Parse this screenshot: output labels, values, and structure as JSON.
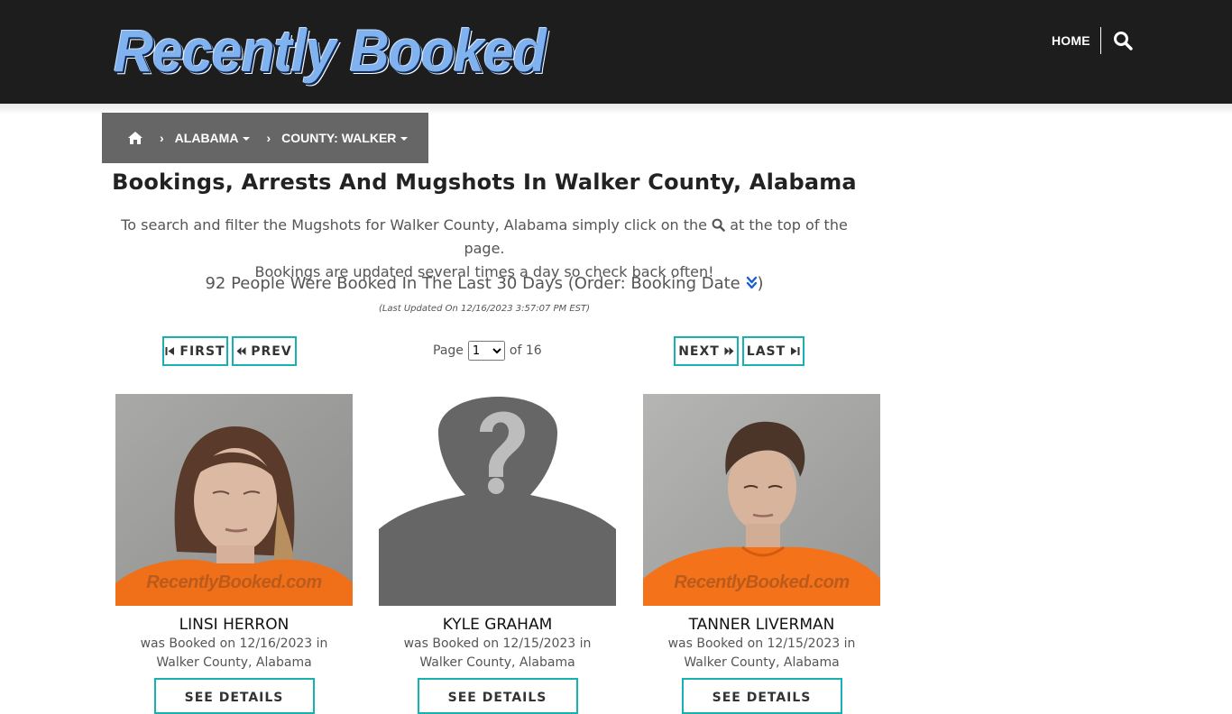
{
  "header": {
    "logo_text": "Recently Booked",
    "nav_home": "HOME",
    "search_icon": "search-icon"
  },
  "breadcrumb": {
    "home_icon": "home-icon",
    "state": "ALABAMA",
    "county": "COUNTY: WALKER"
  },
  "main": {
    "title": "Bookings, Arrests And Mugshots In Walker County, Alabama",
    "intro_before": "To search and filter the Mugshots for Walker County, Alabama simply click on the",
    "intro_after": "at the top of the page.",
    "intro_line2": "Bookings are updated several times a day so check back often!",
    "count_text": "92 People Were Booked In The Last 30 Days (Order: Booking Date",
    "count_close": ")",
    "updated": "(Last Updated On 12/16/2023 3:57:07 PM EST)"
  },
  "pagination": {
    "first": "FIRST",
    "prev": "PREV",
    "next": "NEXT",
    "last": "LAST",
    "page_label": "Page",
    "page_value": "1",
    "of_label": "of 16"
  },
  "cards": [
    {
      "name": "LINSI HERRON",
      "booked": "was Booked on 12/16/2023 in",
      "location": "Walker County, Alabama",
      "watermark": "RecentlyBooked.com",
      "button": "SEE DETAILS"
    },
    {
      "name": "KYLE GRAHAM",
      "booked": "was Booked on 12/15/2023 in",
      "location": "Walker County, Alabama",
      "watermark": "",
      "button": "SEE DETAILS"
    },
    {
      "name": "TANNER LIVERMAN",
      "booked": "was Booked on 12/15/2023 in",
      "location": "Walker County, Alabama",
      "watermark": "RecentlyBooked.com",
      "button": "SEE DETAILS"
    }
  ],
  "colors": {
    "header_bg": "#1d1d1d",
    "breadcrumb_bg": "#666666",
    "accent_teal": "#18b1b1",
    "order_icon": "#1a5fd6"
  }
}
